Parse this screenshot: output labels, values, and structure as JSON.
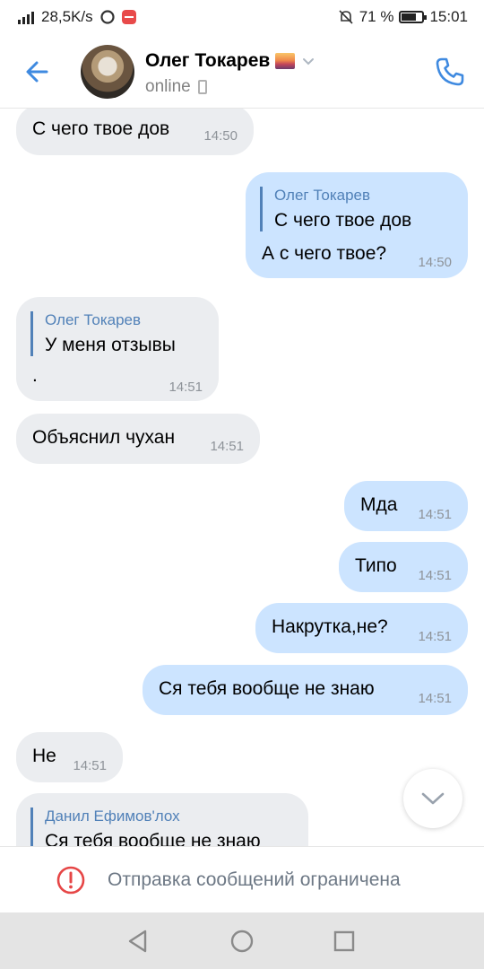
{
  "status_bar": {
    "network_speed": "28,5K/s",
    "battery_percent": "71 %",
    "battery_level": 0.71,
    "time": "15:01"
  },
  "header": {
    "contact_name": "Олег Токарев",
    "contact_status": "online"
  },
  "messages": [
    {
      "direction": "incoming",
      "text": "С чего твое дов",
      "time": "14:50"
    },
    {
      "direction": "outgoing",
      "quote_author": "Олег Токарев",
      "quote_text": "С чего твое дов",
      "text": "А с чего твое?",
      "time": "14:50"
    },
    {
      "direction": "incoming",
      "quote_author": "Олег Токарев",
      "quote_text": "У меня отзывы",
      "text": ".",
      "time": "14:51"
    },
    {
      "direction": "incoming",
      "text": "Объяснил чухан",
      "time": "14:51"
    },
    {
      "direction": "outgoing",
      "text": "Мда",
      "time": "14:51"
    },
    {
      "direction": "outgoing",
      "text": "Типо",
      "time": "14:51"
    },
    {
      "direction": "outgoing",
      "text": "Накрутка,не?",
      "time": "14:51"
    },
    {
      "direction": "outgoing",
      "text": "Ся тебя вообще не знаю",
      "time": "14:51"
    },
    {
      "direction": "incoming",
      "text": "Не",
      "time": "14:51"
    },
    {
      "direction": "incoming",
      "quote_author": "Данил Ефимов'лох",
      "quote_text": "Ся тебя вообще не знаю",
      "text": "",
      "time": ""
    }
  ],
  "restriction_text": "Отправка сообщений ограничена",
  "colors": {
    "accent": "#5181b8",
    "incoming_bubble": "#ebedf0",
    "outgoing_bubble": "#cce4ff",
    "warning": "#e64646"
  },
  "icons": [
    "signal-icon",
    "app-notification-icon",
    "mute-icon",
    "battery-icon",
    "back-arrow-icon",
    "chevron-down-icon",
    "phone-call-icon",
    "scroll-down-icon",
    "warning-icon",
    "nav-back-icon",
    "nav-home-icon",
    "nav-recents-icon"
  ]
}
